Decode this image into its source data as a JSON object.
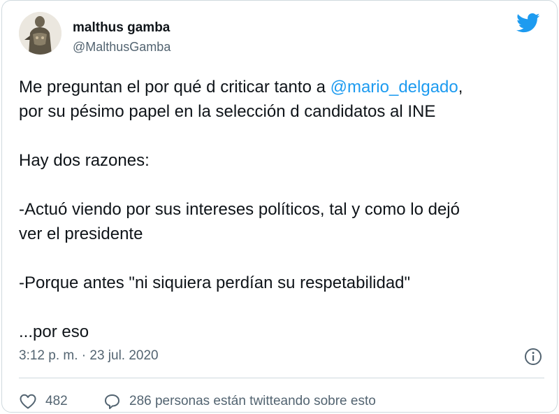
{
  "author": {
    "display_name": "malthus gamba",
    "handle": "@MalthusGamba",
    "avatar_icon": "statue-avatar"
  },
  "tweet": {
    "line1_pre": "Me preguntan el por qué d criticar tanto a ",
    "line1_mention": "@mario_delgado",
    "line1_post": ",",
    "line2": "por su pésimo papel en la selección d candidatos al INE",
    "line3": "Hay dos razones:",
    "line4": "-Actuó viendo por sus intereses políticos, tal y como lo dejó",
    "line5": "ver el presidente",
    "line6": "-Porque antes \"ni siquiera perdían su respetabilidad\"",
    "line7": "...por eso"
  },
  "meta": {
    "timestamp": "3:12 p. m. · 23 jul. 2020"
  },
  "actions": {
    "likes": "482",
    "talk": "286 personas están twitteando sobre esto"
  },
  "colors": {
    "accent": "#1d9bf0",
    "secondary_text": "#536471",
    "like_icon": "#536471"
  }
}
